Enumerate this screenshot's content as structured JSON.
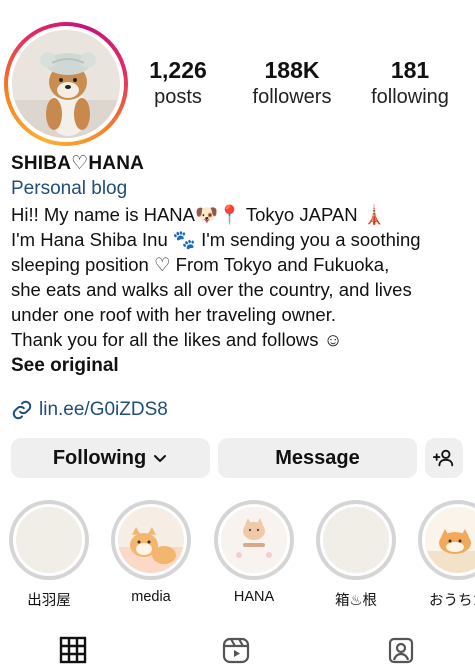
{
  "profile": {
    "stats": [
      {
        "value": "1,226",
        "label": "posts"
      },
      {
        "value": "188K",
        "label": "followers"
      },
      {
        "value": "181",
        "label": "following"
      }
    ],
    "display_name": "SHIBA♡HANA",
    "category": "Personal blog",
    "bio_lines": [
      "Hi!! My name is HANA🐶📍 Tokyo JAPAN 🗼",
      "I'm Hana Shiba Inu 🐾 I'm sending you a soothing",
      "sleeping position ♡ From Tokyo and Fukuoka,",
      "she eats and walks all over the country, and lives",
      "under one roof with her traveling owner.",
      "Thank you for all the likes and follows ☺"
    ],
    "see_original": "See original",
    "link": "lin.ee/G0iZDS8"
  },
  "actions": {
    "following": "Following",
    "message": "Message"
  },
  "highlights": [
    {
      "label": "出羽屋"
    },
    {
      "label": "media"
    },
    {
      "label": "HANA"
    },
    {
      "label": "箱♨根"
    },
    {
      "label": "おうちカ"
    }
  ],
  "tabs": [
    "grid-icon",
    "reels-icon",
    "tagged-icon"
  ]
}
